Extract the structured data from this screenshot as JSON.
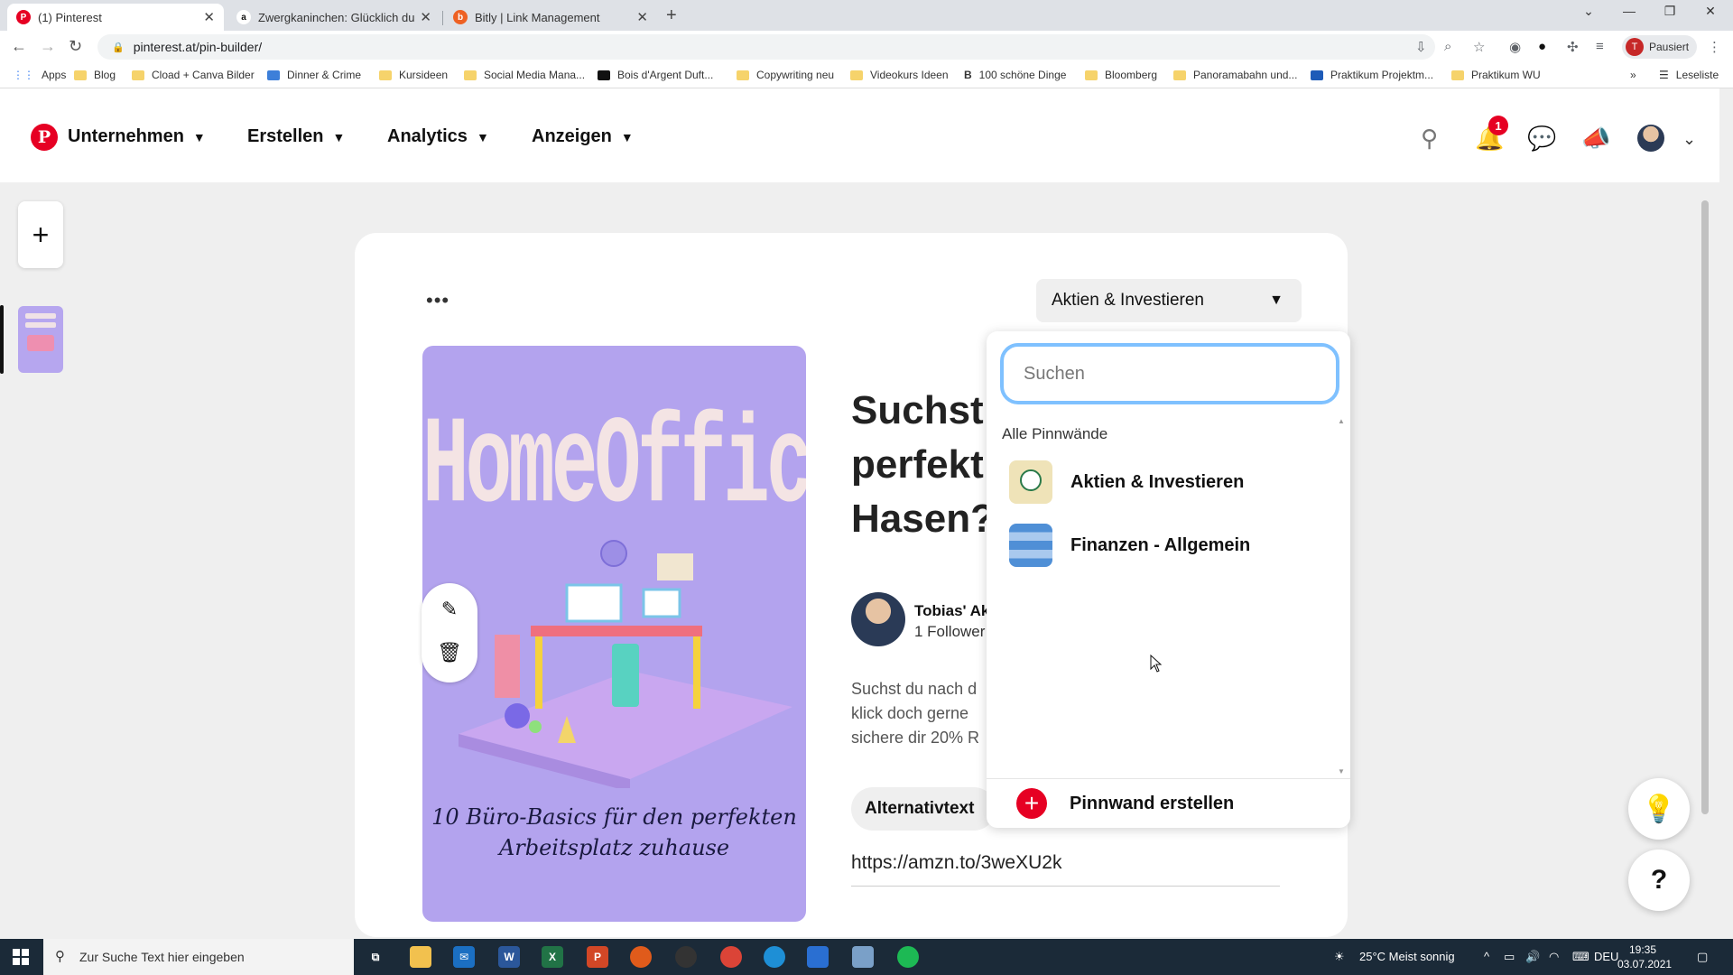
{
  "browser": {
    "tabs": [
      {
        "title": "(1) Pinterest"
      },
      {
        "title": "Zwergkaninchen: Glücklich durch"
      },
      {
        "title": "Bitly | Link Management"
      }
    ],
    "url": "pinterest.at/pin-builder/",
    "profile_label": "Pausiert",
    "profile_initial": "T",
    "bookmarks": [
      "Apps",
      "Blog",
      "Cload + Canva Bilder",
      "Dinner & Crime",
      "Kursideen",
      "Social Media Mana...",
      "Bois d'Argent Duft...",
      "Copywriting neu",
      "Videokurs Ideen",
      "100 schöne Dinge",
      "Bloomberg",
      "Panoramabahn und...",
      "Praktikum Projektm...",
      "Praktikum WU"
    ],
    "reading_list": "Leseliste"
  },
  "header": {
    "nav": [
      "Unternehmen",
      "Erstellen",
      "Analytics",
      "Anzeigen"
    ],
    "notification_count": "1"
  },
  "pin": {
    "board_selected": "Aktien & Investieren",
    "image_title": "HomeOffice",
    "image_caption": "10 Büro-Basics für den perfekten Arbeitsplatz zuhause",
    "title": "Suchst du nach dem perfekten Hasen?",
    "title_visible": [
      "Suchst",
      "perfekt",
      "Hasen?"
    ],
    "author_name": "Tobias' Ak",
    "author_followers": "1 Follower",
    "description_lines": [
      "Suchst du nach d",
      "klick doch gerne",
      "sichere dir 20% R"
    ],
    "alt_text_label": "Alternativtext",
    "link": "https://amzn.to/3weXU2k"
  },
  "dropdown": {
    "search_placeholder": "Suchen",
    "section_heading": "Alle Pinnwände",
    "boards": [
      {
        "name": "Aktien & Investieren"
      },
      {
        "name": "Finanzen - Allgemein"
      }
    ],
    "create_label": "Pinnwand erstellen"
  },
  "taskbar": {
    "search_placeholder": "Zur Suche Text hier eingeben",
    "weather": "25°C  Meist sonnig",
    "language": "DEU",
    "time": "19:35",
    "date": "03.07.2021"
  }
}
